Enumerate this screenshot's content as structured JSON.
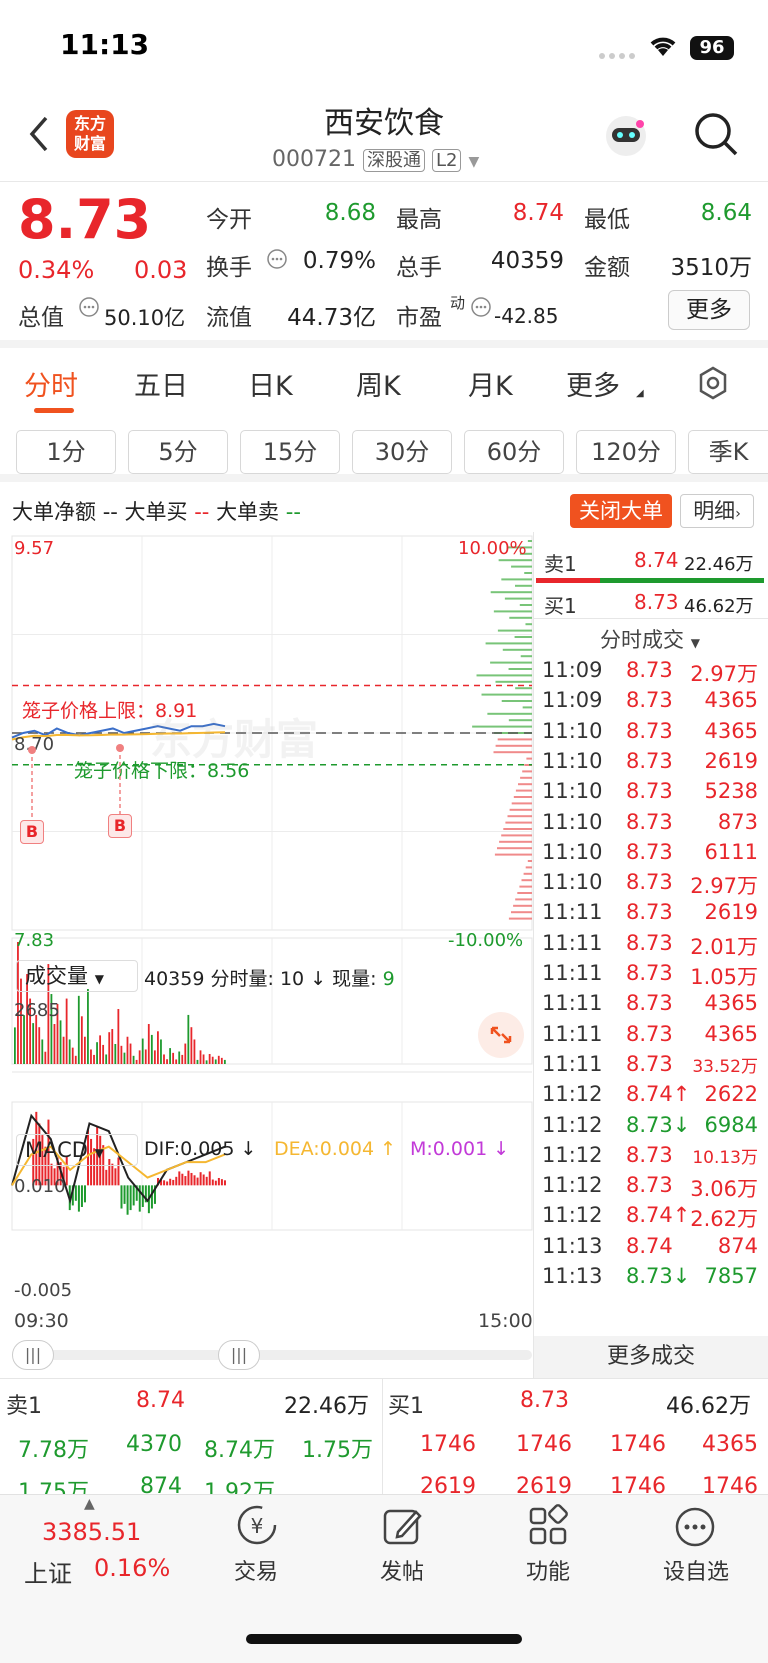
{
  "status": {
    "time": "11:13",
    "battery": "96"
  },
  "header": {
    "logo_line1": "东方",
    "logo_line2": "财富",
    "stock_name": "西安饮食",
    "stock_code": "000721",
    "tag1": "深股通",
    "tag2": "L2"
  },
  "quote": {
    "price": "8.73",
    "change_pct": "0.34%",
    "change": "0.03",
    "open_label": "今开",
    "open": "8.68",
    "high_label": "最高",
    "high": "8.74",
    "low_label": "最低",
    "low": "8.64",
    "turnover_label": "换手",
    "turnover": "0.79%",
    "volume_label": "总手",
    "volume": "40359",
    "amount_label": "金额",
    "amount": "3510万",
    "mktcap_label": "总值",
    "mktcap": "50.10亿",
    "float_label": "流值",
    "float": "44.73亿",
    "pe_label": "市盈",
    "pe_sup": "动",
    "pe": "-42.85",
    "more": "更多"
  },
  "tabs": [
    "分时",
    "五日",
    "日K",
    "周K",
    "月K",
    "更多"
  ],
  "periods": [
    "1分",
    "5分",
    "15分",
    "30分",
    "60分",
    "120分",
    "季K"
  ],
  "bigorder": {
    "net": "大单净额",
    "buy": "大单买",
    "sell": "大单卖",
    "dash": "--",
    "close_btn": "关闭大单",
    "detail_btn": "明细"
  },
  "chart": {
    "top_price": "9.57",
    "bottom_price": "7.83",
    "top_pct": "10.00%",
    "bottom_pct": "-10.00%",
    "mid_price": "8.70",
    "upper_limit": "笼子价格上限：8.91",
    "lower_limit": "笼子价格下限：8.56",
    "b_marker": "B",
    "watermark": "东方财富",
    "vol_selector": "成交量",
    "vol_total": "40359",
    "vol_tick_label": "分时量:",
    "vol_tick": "10",
    "vol_now_label": "现量:",
    "vol_now": "9",
    "vol_max": "2685",
    "macd_selector": "MACD",
    "dif": "DIF:0.005",
    "dea": "DEA:0.004",
    "m": "M:0.001",
    "macd_top": "0.010",
    "macd_bottom": "-0.005",
    "time_start": "09:30",
    "time_end": "15:00"
  },
  "chart_data": {
    "type": "line",
    "title": "",
    "price_range": [
      7.83,
      9.57
    ],
    "upper_limit": 8.91,
    "lower_limit": 8.56,
    "price": [
      8.68,
      8.7,
      8.71,
      8.69,
      8.72,
      8.7,
      8.69,
      8.7,
      8.71,
      8.72,
      8.7,
      8.71,
      8.72,
      8.73,
      8.72,
      8.71,
      8.73,
      8.73,
      8.74,
      8.73
    ],
    "volume_max": 2685,
    "volumes": [
      2685,
      1800,
      900,
      2200,
      1200,
      600,
      1500,
      400,
      700,
      1100,
      500,
      300,
      800,
      600,
      350,
      250,
      900,
      300,
      200,
      150
    ],
    "macd_range": [
      -0.005,
      0.01
    ],
    "dif": [
      0.0,
      0.009,
      0.006,
      -0.002,
      0.008,
      0.007,
      0.001,
      -0.002,
      0.002,
      0.003,
      0.004,
      0.005
    ],
    "dea": [
      0.0,
      0.004,
      0.005,
      0.002,
      0.004,
      0.005,
      0.003,
      0.001,
      0.002,
      0.003,
      0.003,
      0.004
    ],
    "macd_hist": [
      0.0,
      0.01,
      0.004,
      -0.004,
      0.008,
      0.004,
      -0.004,
      -0.004,
      0.001,
      0.002,
      0.002,
      0.001
    ]
  },
  "level1": {
    "sell_label": "卖1",
    "sell_price": "8.74",
    "sell_vol": "22.46万",
    "buy_label": "买1",
    "buy_price": "8.73",
    "buy_vol": "46.62万"
  },
  "ticks_header": "分时成交",
  "ticks": [
    {
      "t": "11:09",
      "p": "8.73",
      "v": "2.97万",
      "c": "red"
    },
    {
      "t": "11:09",
      "p": "8.73",
      "v": "4365",
      "c": "red"
    },
    {
      "t": "11:10",
      "p": "8.73",
      "v": "4365",
      "c": "red"
    },
    {
      "t": "11:10",
      "p": "8.73",
      "v": "2619",
      "c": "red"
    },
    {
      "t": "11:10",
      "p": "8.73",
      "v": "5238",
      "c": "red"
    },
    {
      "t": "11:10",
      "p": "8.73",
      "v": "873",
      "c": "red"
    },
    {
      "t": "11:10",
      "p": "8.73",
      "v": "6111",
      "c": "red"
    },
    {
      "t": "11:10",
      "p": "8.73",
      "v": "2.97万",
      "c": "red"
    },
    {
      "t": "11:11",
      "p": "8.73",
      "v": "2619",
      "c": "red"
    },
    {
      "t": "11:11",
      "p": "8.73",
      "v": "2.01万",
      "c": "red"
    },
    {
      "t": "11:11",
      "p": "8.73",
      "v": "1.05万",
      "c": "red"
    },
    {
      "t": "11:11",
      "p": "8.73",
      "v": "4365",
      "c": "red"
    },
    {
      "t": "11:11",
      "p": "8.73",
      "v": "4365",
      "c": "red"
    },
    {
      "t": "11:11",
      "p": "8.73",
      "v": "33.52万",
      "c": "red"
    },
    {
      "t": "11:12",
      "p": "8.74↑",
      "v": "2622",
      "c": "red"
    },
    {
      "t": "11:12",
      "p": "8.73↓",
      "v": "6984",
      "c": "green"
    },
    {
      "t": "11:12",
      "p": "8.73",
      "v": "10.13万",
      "c": "red"
    },
    {
      "t": "11:12",
      "p": "8.73",
      "v": "3.06万",
      "c": "red"
    },
    {
      "t": "11:12",
      "p": "8.74↑",
      "v": "2.62万",
      "c": "red"
    },
    {
      "t": "11:13",
      "p": "8.74",
      "v": "874",
      "c": "red"
    },
    {
      "t": "11:13",
      "p": "8.73↓",
      "v": "7857",
      "c": "green"
    }
  ],
  "more_ticks": "更多成交",
  "orderbook": {
    "sell_label": "卖1",
    "sell_price": "8.74",
    "sell_vol": "22.46万",
    "buy_label": "买1",
    "buy_price": "8.73",
    "buy_vol": "46.62万",
    "sell_row1": [
      "7.78万",
      "4370",
      "8.74万",
      "1.75万"
    ],
    "sell_row2": [
      "1.75万",
      "874",
      "1.92万",
      ""
    ],
    "buy_row1": [
      "1746",
      "1746",
      "1746",
      "4365"
    ],
    "buy_row2": [
      "2619",
      "2619",
      "1746",
      "1746"
    ]
  },
  "bottom_nav": {
    "index_value": "3385.51",
    "index_name": "上证",
    "index_pct": "0.16%",
    "trade": "交易",
    "post": "发帖",
    "func": "功能",
    "watch": "设自选"
  }
}
